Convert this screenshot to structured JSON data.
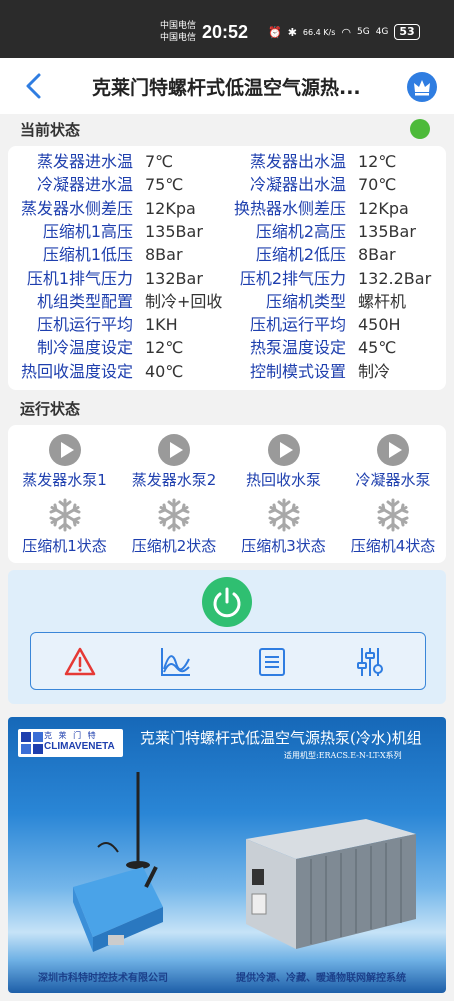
{
  "status_bar": {
    "carrier_1": "中国电信",
    "carrier_2": "中国电信",
    "time": "20:52",
    "net_speed": "66.4 K/s",
    "signal_1": "5G",
    "signal_2": "4G",
    "battery": "53"
  },
  "header": {
    "title": "克莱门特螺杆式低温空气源热..."
  },
  "current_status": {
    "heading": "当前状态",
    "indicator_color": "#4dba3a",
    "rows": [
      {
        "l1": "蒸发器进水温",
        "v1": "7℃",
        "l2": "蒸发器出水温",
        "v2": "12℃"
      },
      {
        "l1": "冷凝器进水温",
        "v1": "75℃",
        "l2": "冷凝器出水温",
        "v2": "70℃"
      },
      {
        "l1": "蒸发器水侧差压",
        "v1": "12Kpa",
        "l2": "换热器水侧差压",
        "v2": "12Kpa"
      },
      {
        "l1": "压缩机1高压",
        "v1": "135Bar",
        "l2": "压缩机2高压",
        "v2": "135Bar"
      },
      {
        "l1": "压缩机1低压",
        "v1": "8Bar",
        "l2": "压缩机2低压",
        "v2": "8Bar"
      },
      {
        "l1": "压机1排气压力",
        "v1": "132Bar",
        "l2": "压机2排气压力",
        "v2": "132.2Bar"
      },
      {
        "l1": "机组类型配置",
        "v1": "制冷+回收",
        "l2": "压缩机类型",
        "v2": "螺杆机"
      },
      {
        "l1": "压机运行平均",
        "v1": "1KH",
        "l2": "压机运行平均",
        "v2": "450H"
      },
      {
        "l1": "制冷温度设定",
        "v1": "12℃",
        "l2": "热泵温度设定",
        "v2": "45℃"
      },
      {
        "l1": "热回收温度设定",
        "v1": "40℃",
        "l2": "控制模式设置",
        "v2": "制冷"
      }
    ]
  },
  "run_status": {
    "heading": "运行状态",
    "pumps": [
      "蒸发器水泵1",
      "蒸发器水泵2",
      "热回收水泵",
      "冷凝器水泵"
    ],
    "compressors": [
      "压缩机1状态",
      "压缩机2状态",
      "压缩机3状态",
      "压缩机4状态"
    ]
  },
  "controls": {
    "power_icon": "power-icon",
    "tools": [
      "alarm-icon",
      "chart-icon",
      "list-icon",
      "settings-sliders-icon"
    ],
    "accent": "#2fbf71"
  },
  "banner": {
    "logo_cn": "克 莱 门 特",
    "logo_en": "CLIMAVENETA",
    "title": "克莱门特螺杆式低温空气源热泵(冷水)机组",
    "subtitle": "适用机型:ERACS.E-N-LT-X系列",
    "footer_left": "深圳市科特时控技术有限公司",
    "footer_right": "提供冷源、冷藏、暖通物联网解控系统"
  }
}
